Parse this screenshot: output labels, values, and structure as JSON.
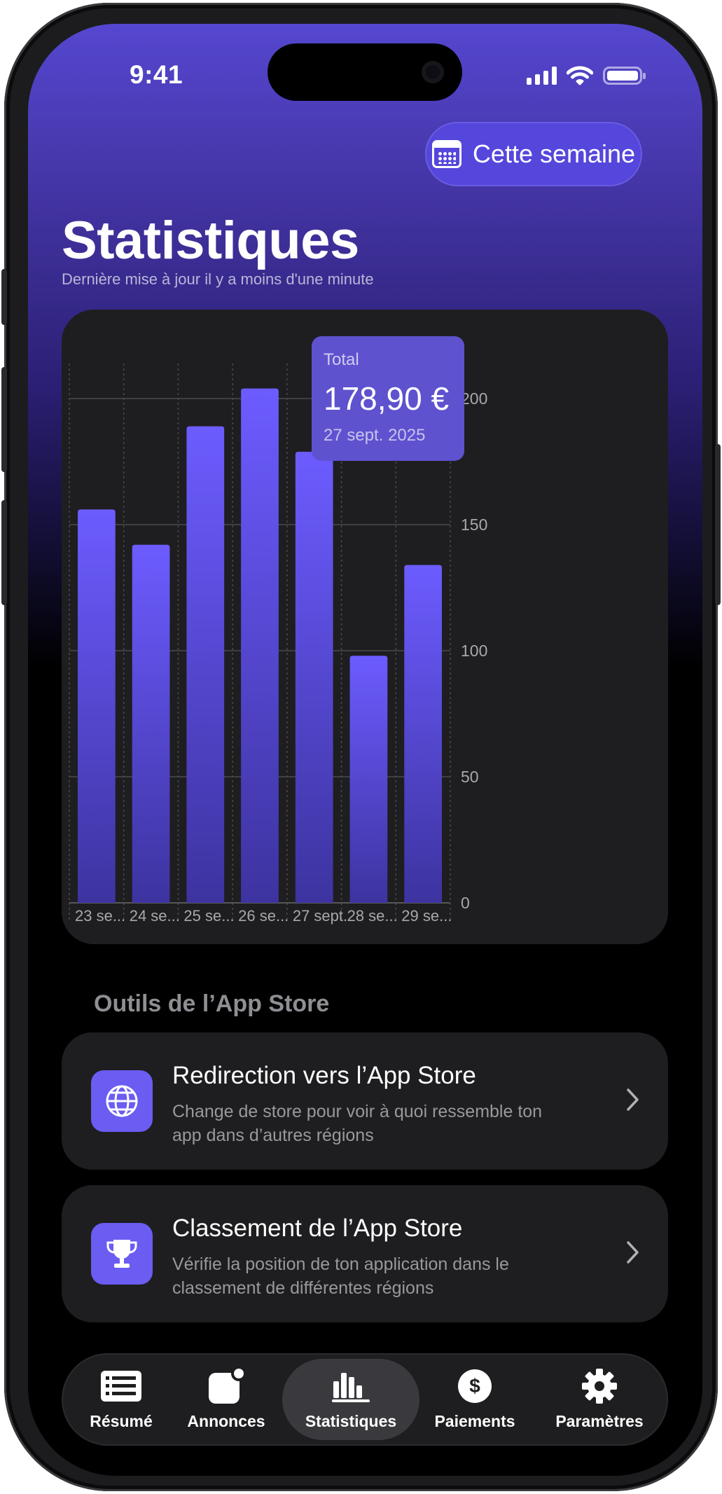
{
  "status_bar": {
    "time": "9:41"
  },
  "header": {
    "period_button": "Cette semaine",
    "title": "Statistiques",
    "subtitle": "Dernière mise à jour il y a moins d'une minute"
  },
  "chart_data": {
    "type": "bar",
    "categories": [
      "23 se...",
      "24 se...",
      "25 se...",
      "26 se...",
      "27 sept.",
      "28 se...",
      "29 se..."
    ],
    "values": [
      156,
      142,
      189,
      204,
      178.9,
      98,
      134
    ],
    "ylim": [
      0,
      225
    ],
    "yticks": [
      0,
      50,
      100,
      150,
      200
    ],
    "y_axis_position": "right",
    "grid": true,
    "selected_index": 4,
    "bar_color": "#6c5cff",
    "tooltip": {
      "label": "Total",
      "value": "178,90 €",
      "date": "27 sept. 2025"
    }
  },
  "tools": {
    "section_title": "Outils de l’App Store",
    "items": [
      {
        "title": "Redirection vers l’App Store",
        "description": "Change de store pour voir à quoi ressemble ton app dans d’autres régions",
        "icon": "globe-icon"
      },
      {
        "title": "Classement de l’App Store",
        "description": "Vérifie la position de ton application dans le classement de différentes régions",
        "icon": "trophy-icon"
      }
    ]
  },
  "tab_bar": {
    "items": [
      {
        "label": "Résumé",
        "icon": "list-icon"
      },
      {
        "label": "Annonces",
        "icon": "badge-icon"
      },
      {
        "label": "Statistiques",
        "icon": "bar-chart-icon",
        "active": true
      },
      {
        "label": "Paiements",
        "icon": "dollar-icon"
      },
      {
        "label": "Paramètres",
        "icon": "gear-icon"
      }
    ]
  },
  "colors": {
    "accent": "#6c5cff",
    "card": "#1e1e20",
    "header_top": "#5547d0"
  }
}
